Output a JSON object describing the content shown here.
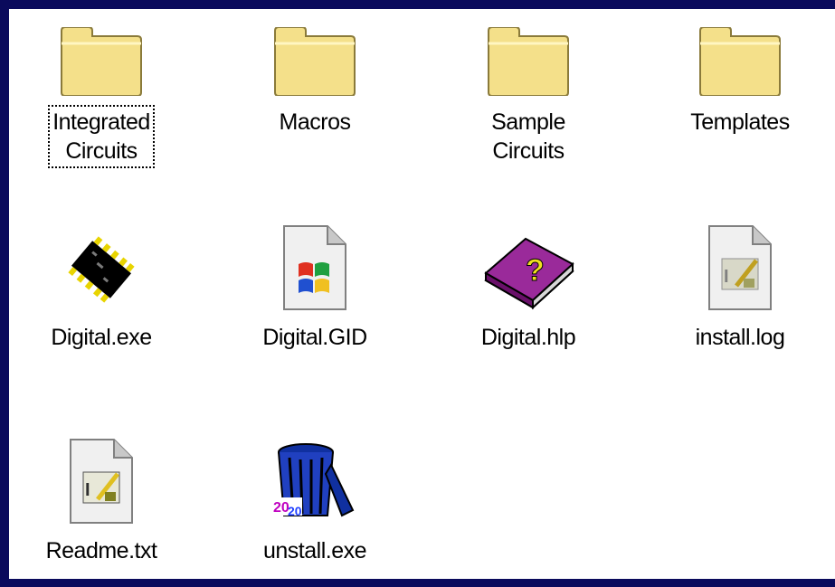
{
  "window": {
    "title": ""
  },
  "items": [
    {
      "line1": "Integrated",
      "line2": "Circuits",
      "icon": "folder-icon",
      "focused": true
    },
    {
      "line1": "Macros",
      "line2": "",
      "icon": "folder-icon"
    },
    {
      "line1": "Sample",
      "line2": "Circuits",
      "icon": "folder-icon"
    },
    {
      "line1": "Templates",
      "line2": "",
      "icon": "folder-icon"
    },
    {
      "line1": "Digital.exe",
      "line2": "",
      "icon": "chip-icon"
    },
    {
      "line1": "Digital.GID",
      "line2": "",
      "icon": "windows-file-icon"
    },
    {
      "line1": "Digital.hlp",
      "line2": "",
      "icon": "help-book-icon"
    },
    {
      "line1": "install.log",
      "line2": "",
      "icon": "text-document-icon"
    },
    {
      "line1": "Readme.txt",
      "line2": "",
      "icon": "text-document-icon"
    },
    {
      "line1": "unstall.exe",
      "line2": "",
      "icon": "recycle-bin-icon"
    }
  ],
  "colors": {
    "background": "#0a0a5c",
    "folder": "#f4e08a",
    "selection_outline": "#000000"
  }
}
